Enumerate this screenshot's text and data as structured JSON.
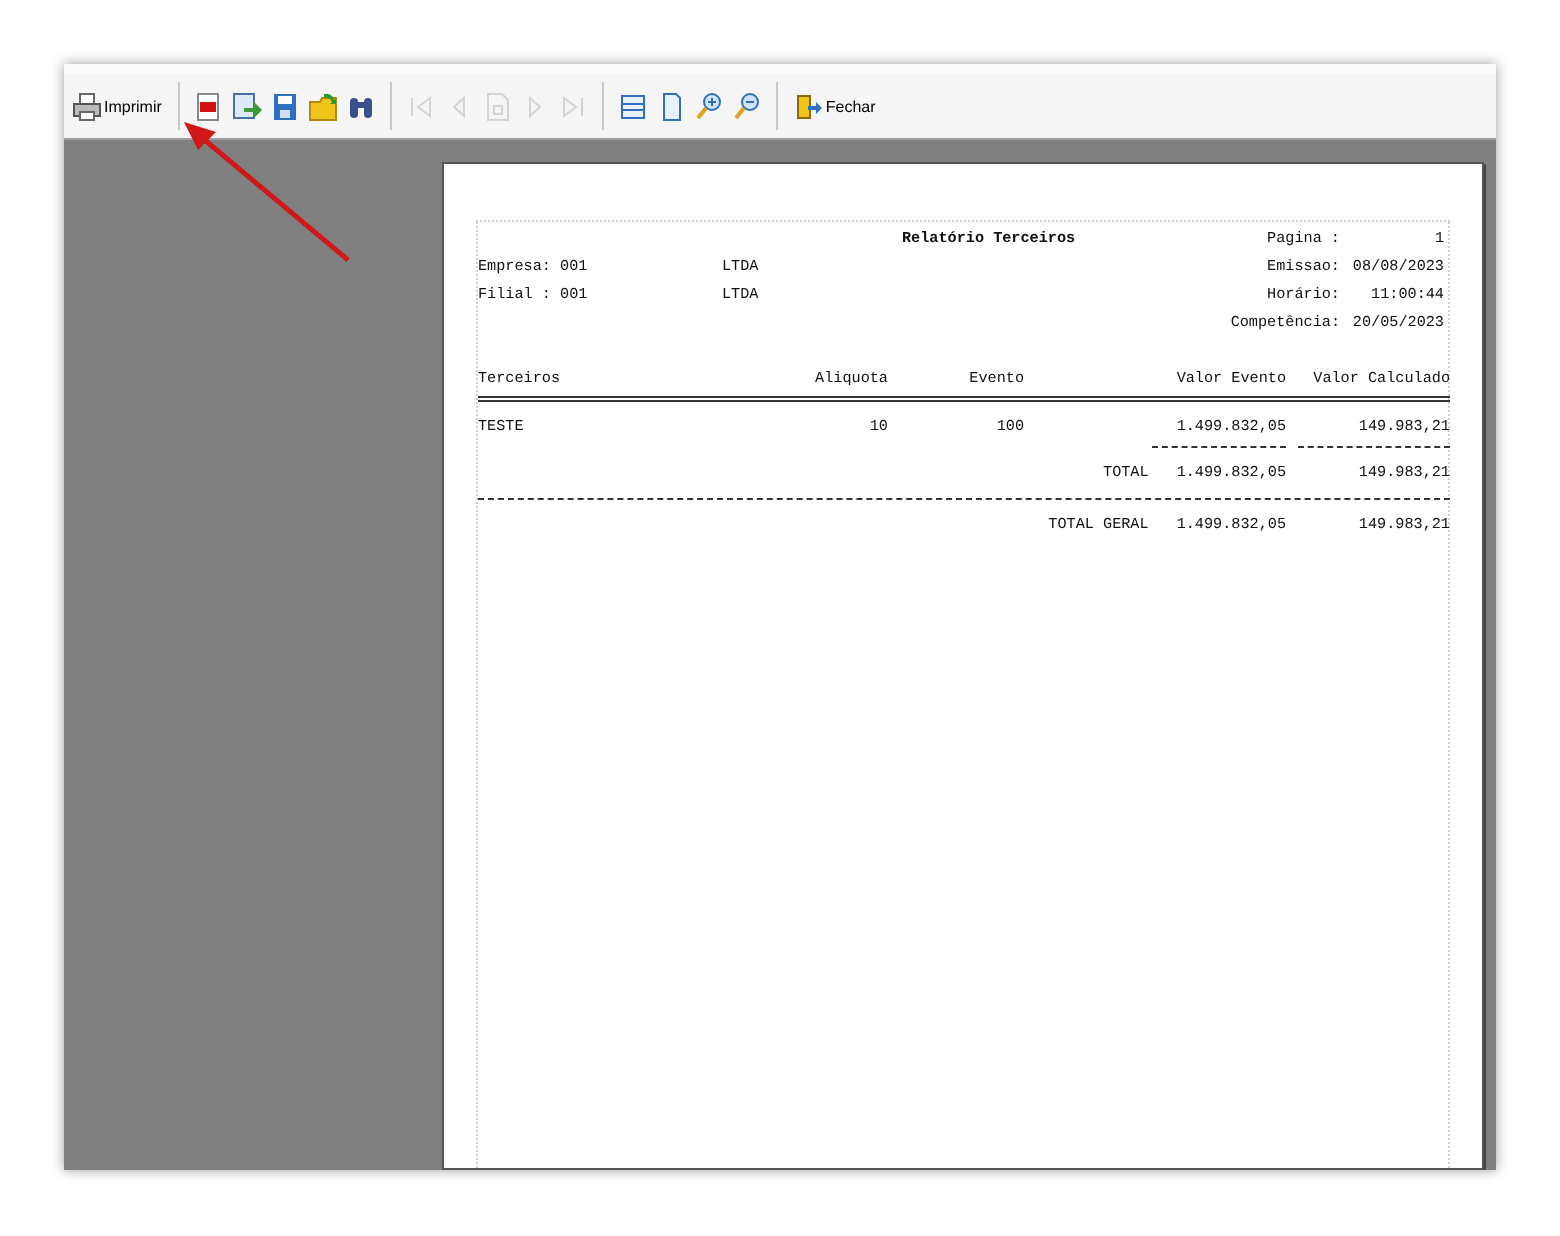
{
  "toolbar": {
    "print_button": {
      "label": "Imprimir"
    },
    "tools": [
      {
        "kind": "pdf",
        "disabled": false
      },
      {
        "kind": "export",
        "disabled": false
      },
      {
        "kind": "save",
        "disabled": false
      },
      {
        "kind": "open",
        "disabled": false
      },
      {
        "kind": "find",
        "disabled": false
      },
      {
        "kind": "first",
        "disabled": true
      },
      {
        "kind": "prev",
        "disabled": true
      },
      {
        "kind": "page",
        "disabled": true
      },
      {
        "kind": "next",
        "disabled": true
      },
      {
        "kind": "last",
        "disabled": true
      },
      {
        "kind": "width",
        "disabled": false
      },
      {
        "kind": "whole",
        "disabled": false
      },
      {
        "kind": "zoomin",
        "disabled": false
      },
      {
        "kind": "zoomout",
        "disabled": false
      }
    ],
    "close_button": {
      "label": "Fechar"
    }
  },
  "report": {
    "title": "Relatório Terceiros",
    "header_left": [
      {
        "label": "Empresa: 001",
        "name": "LTDA"
      },
      {
        "label": "Filial : 001",
        "name": "LTDA"
      }
    ],
    "header_right": [
      {
        "label": "Pagina :",
        "value": "1"
      },
      {
        "label": "Emissao:",
        "value": "08/08/2023"
      },
      {
        "label": "Horário:",
        "value": "11:00:44"
      },
      {
        "label": "Competência:",
        "value": "20/05/2023"
      }
    ],
    "columns": [
      "Terceiros",
      "Aliquota",
      "Evento",
      "Valor Evento",
      "Valor Calculado"
    ],
    "rows": [
      {
        "cells": [
          "TESTE",
          "10",
          "100",
          "1.499.832,05",
          "149.983,21"
        ]
      }
    ],
    "total": {
      "label": "TOTAL",
      "valor_evento": "1.499.832,05",
      "valor_calculado": "149.983,21"
    },
    "grand_total": {
      "label": "TOTAL GERAL",
      "valor_evento": "1.499.832,05",
      "valor_calculado": "149.983,21"
    }
  }
}
